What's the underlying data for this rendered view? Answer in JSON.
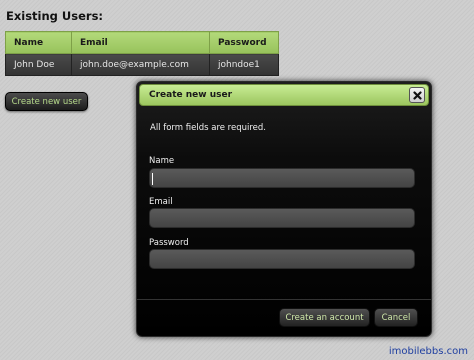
{
  "existing_users": {
    "title": "Existing Users:",
    "columns": [
      "Name",
      "Email",
      "Password"
    ],
    "rows": [
      [
        "John Doe",
        "john.doe@example.com",
        "johndoe1"
      ]
    ]
  },
  "create_button_label": "Create new user",
  "dialog": {
    "title": "Create new user",
    "close_icon": "close-icon",
    "note": "All form fields are required.",
    "fields": {
      "name_label": "Name",
      "name_value": "",
      "email_label": "Email",
      "email_value": "",
      "password_label": "Password",
      "password_value": ""
    },
    "create_account_label": "Create an account",
    "cancel_label": "Cancel"
  },
  "watermark": "imobilebbs.com",
  "colors": {
    "accent_green": "#9cc65f",
    "dialog_bg": "#000000",
    "page_bg": "#cfcfcf"
  }
}
